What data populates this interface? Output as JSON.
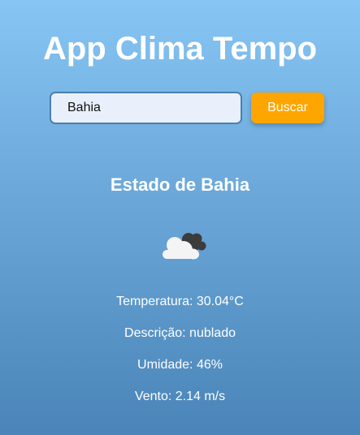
{
  "app": {
    "title": "App Clima Tempo"
  },
  "search": {
    "value": "Bahia",
    "button_label": "Buscar"
  },
  "weather": {
    "location": "Estado de Bahia",
    "icon": "cloud-icon",
    "lines": [
      "Temperatura: 30.04°C",
      "Descrição: nublado",
      "Umidade: 46%",
      "Vento: 2.14 m/s"
    ]
  },
  "colors": {
    "background_top": "#86c5f4",
    "background_bottom": "#4a84b8",
    "button": "#ffa500",
    "input_background": "#e9f0fb",
    "input_border": "#4b7fae"
  }
}
